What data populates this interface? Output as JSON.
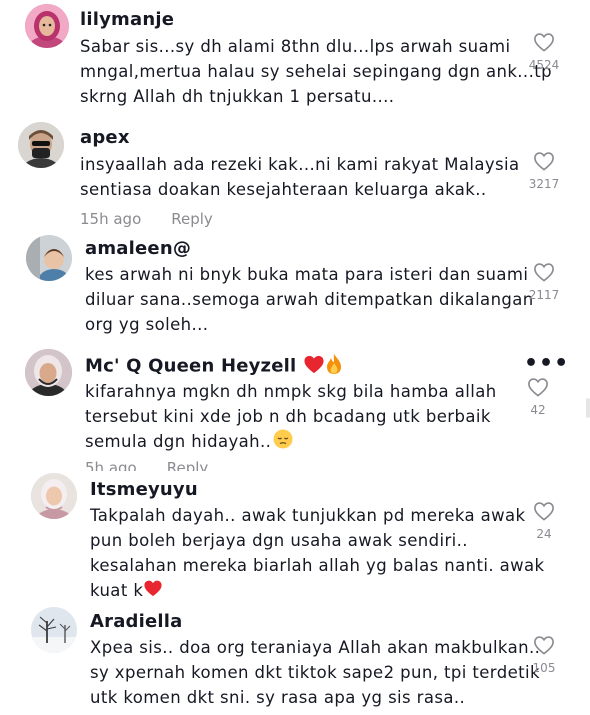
{
  "comments": [
    {
      "username": "lilymanje",
      "lines": [
        "Sabar sis...sy dh alami 8thn dlu...lps arwah suami",
        "mngal,mertua halau sy sehelai sepingang dgn ank...tp",
        "skrng Allah dh tnjukkan 1 persatu...."
      ],
      "likes": "4524"
    },
    {
      "username": "apex",
      "lines": [
        "insyaallah ada rezeki kak...ni kami rakyat Malaysia",
        "sentiasa doakan kesejahteraan keluarga akak.."
      ],
      "likes": "3217",
      "time": "15h ago",
      "reply": "Reply"
    },
    {
      "username": "amaleen@",
      "lines": [
        "kes arwah ni bnyk buka mata para isteri dan suami",
        "diluar sana..semoga arwah ditempatkan dikalangan",
        "org yg soleh..."
      ],
      "likes": "2117"
    },
    {
      "username": "Mc' Q Queen Heyzell",
      "lines": [
        "kifarahnya mgkn dh nmpk skg bila hamba allah",
        "tersebut kini xde job n dh bcadang utk berbaik",
        "semula dgn hidayah.."
      ],
      "likes": "42",
      "time": "5h ago",
      "reply": "Reply",
      "more": "•••"
    },
    {
      "username": "Itsmeyuyu",
      "lines": [
        "Takpalah dayah.. awak tunjukkan pd mereka awak",
        "pun boleh berjaya dgn usaha awak sendiri..",
        "kesalahan mereka biarlah allah yg balas nanti. awak",
        "kuat k"
      ],
      "likes": "24"
    },
    {
      "username": "Aradiella",
      "lines": [
        "Xpea sis.. doa org teraniaya Allah akan makbulkan..",
        "sy xpernah komen dkt tiktok sape2 pun, tpi terdetik",
        "utk komen dkt sni. sy rasa apa yg sis rasa.."
      ],
      "likes": "105"
    }
  ],
  "icons": {
    "like": "heart-outline-icon",
    "emoji_heart": "red-heart-emoji",
    "emoji_fire": "fire-emoji",
    "emoji_pensive": "pensive-face-emoji"
  },
  "colors": {
    "text": "#161823",
    "meta": "#8a8b91",
    "heart_red": "#e8262f"
  }
}
